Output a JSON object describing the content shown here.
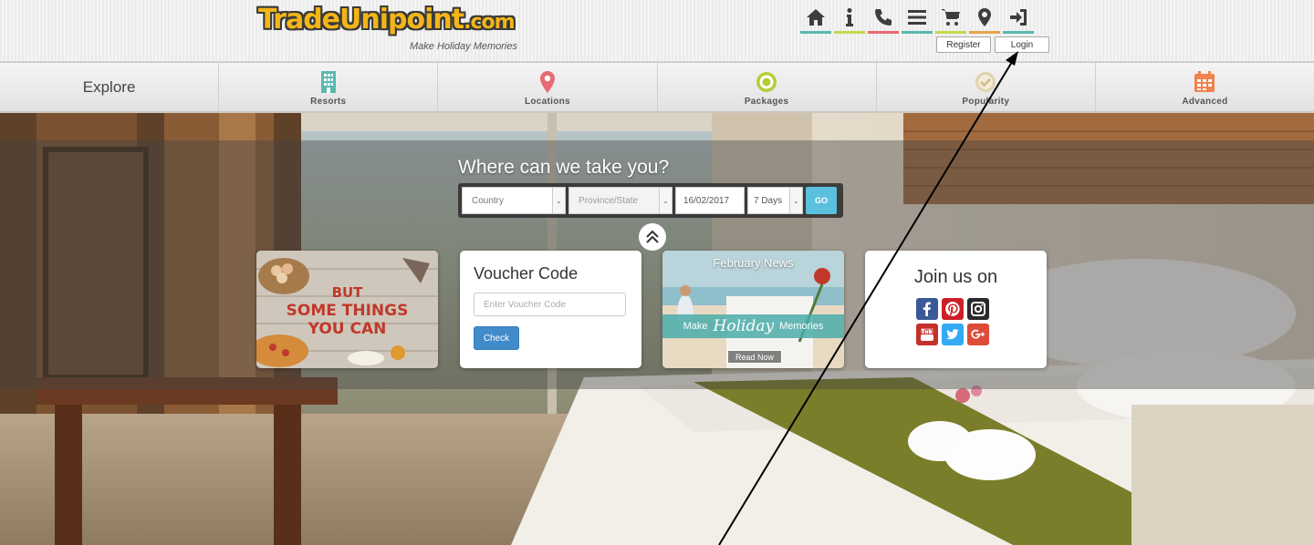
{
  "brand": {
    "logo_main": "TradeUnipoint",
    "logo_suffix": ".com",
    "tagline": "Make Holiday Memories"
  },
  "topbar": {
    "icons": [
      {
        "name": "home-icon",
        "color": "#5bb8b0"
      },
      {
        "name": "info-icon",
        "color": "#c4d94e"
      },
      {
        "name": "phone-icon",
        "color": "#e86a73"
      },
      {
        "name": "menu-icon",
        "color": "#5bb8b0"
      },
      {
        "name": "cart-icon",
        "color": "#c4d94e"
      },
      {
        "name": "location-icon",
        "color": "#e8a34a"
      },
      {
        "name": "login-icon",
        "color": "#5bb8b0"
      }
    ],
    "register_label": "Register",
    "login_label": "Login"
  },
  "nav": {
    "explore_label": "Explore",
    "items": [
      {
        "label": "Resorts",
        "icon": "building-icon",
        "color": "#5bb8b0"
      },
      {
        "label": "Locations",
        "icon": "location-pin-icon",
        "color": "#e86a73"
      },
      {
        "label": "Packages",
        "icon": "target-icon",
        "color": "#b4cd39"
      },
      {
        "label": "Popularity",
        "icon": "check-circle-icon",
        "color": "#e0d3ad"
      },
      {
        "label": "Advanced",
        "icon": "calendar-icon",
        "color": "#f0834f"
      }
    ]
  },
  "search": {
    "title": "Where can we take you?",
    "country_value": "Country",
    "province_value": "Province/State",
    "date_value": "16/02/2017",
    "days_value": "7 Days",
    "go_label": "GO"
  },
  "cards": {
    "promo": {
      "line1": "BUT",
      "line2": "SOME THINGS",
      "line3": "YOU CAN"
    },
    "voucher": {
      "title": "Voucher Code",
      "placeholder": "Enter Voucher Code",
      "check_label": "Check"
    },
    "news": {
      "title": "February News",
      "banner_left": "Make",
      "banner_script": "Holiday",
      "banner_right": "Memories",
      "read_label": "Read Now"
    },
    "social": {
      "title": "Join us on",
      "icons": [
        {
          "name": "facebook-icon",
          "color": "#3b5998"
        },
        {
          "name": "pinterest-icon",
          "color": "#cb2027"
        },
        {
          "name": "instagram-icon",
          "color": "#2a2a2a"
        },
        {
          "name": "youtube-icon",
          "color": "#c4302b"
        },
        {
          "name": "twitter-icon",
          "color": "#33aaf3"
        },
        {
          "name": "googleplus-icon",
          "color": "#dd4b39"
        }
      ]
    }
  }
}
